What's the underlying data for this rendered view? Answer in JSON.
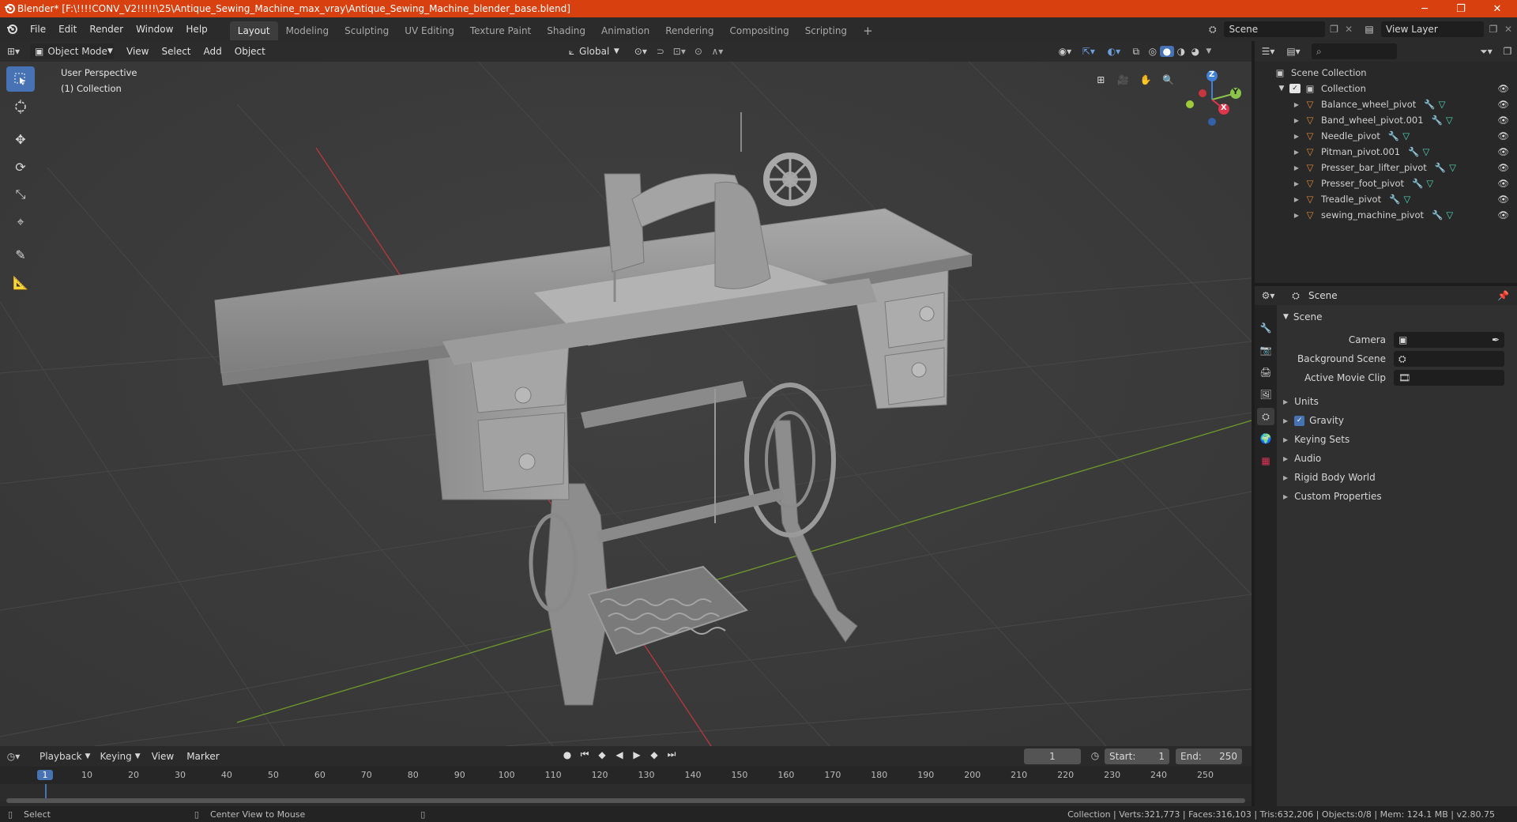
{
  "window": {
    "title": "Blender* [F:\\!!!!CONV_V2!!!!!\\25\\Antique_Sewing_Machine_max_vray\\Antique_Sewing_Machine_blender_base.blend]",
    "minimize": "─",
    "maximize": "❐",
    "close": "✕"
  },
  "menu": {
    "items": [
      "File",
      "Edit",
      "Render",
      "Window",
      "Help"
    ],
    "workspaces": [
      "Layout",
      "Modeling",
      "Sculpting",
      "UV Editing",
      "Texture Paint",
      "Shading",
      "Animation",
      "Rendering",
      "Compositing",
      "Scripting"
    ],
    "add_tab": "+",
    "scene_name": "Scene",
    "view_layer": "View Layer"
  },
  "viewport": {
    "mode": "Object Mode",
    "menus": [
      "View",
      "Select",
      "Add",
      "Object"
    ],
    "orientation": "Global",
    "perspective_label": "User Perspective",
    "collection_label": "(1) Collection",
    "gizmo_axes": [
      "X",
      "Y",
      "Z"
    ]
  },
  "outliner": {
    "search_placeholder": "",
    "scene_collection": "Scene Collection",
    "collection": "Collection",
    "objects": [
      "Balance_wheel_pivot",
      "Band_wheel_pivot.001",
      "Needle_pivot",
      "Pitman_pivot.001",
      "Presser_bar_lifter_pivot",
      "Presser_foot_pivot",
      "Treadle_pivot",
      "sewing_machine_pivot"
    ]
  },
  "properties": {
    "header": "Scene",
    "section": "Scene",
    "fields": [
      {
        "label": "Camera",
        "value": ""
      },
      {
        "label": "Background Scene",
        "value": ""
      },
      {
        "label": "Active Movie Clip",
        "value": ""
      }
    ],
    "panels": [
      "Units",
      "Gravity",
      "Keying Sets",
      "Audio",
      "Rigid Body World",
      "Custom Properties"
    ],
    "gravity_enabled": true
  },
  "timeline": {
    "menus": [
      "Playback",
      "Keying",
      "View",
      "Marker"
    ],
    "current_frame": "1",
    "start_label": "Start:",
    "start": "1",
    "end_label": "End:",
    "end": "250",
    "ruler": [
      "1",
      "10",
      "20",
      "30",
      "40",
      "50",
      "60",
      "70",
      "80",
      "90",
      "100",
      "110",
      "120",
      "130",
      "140",
      "150",
      "160",
      "170",
      "180",
      "190",
      "200",
      "210",
      "220",
      "230",
      "240",
      "250"
    ]
  },
  "status": {
    "left_action": "Select",
    "middle_action": "Center View to Mouse",
    "stats": "Collection | Verts:321,773 | Faces:316,103 | Tris:632,206 | Objects:0/8 | Mem: 124.1 MB | v2.80.75"
  },
  "colors": {
    "title_bar": "#d8400f",
    "accent": "#4772b3",
    "x_axis": "#e0354b",
    "y_axis": "#8bc34a",
    "z_axis": "#3f7fd4",
    "object_icon": "#e08a3a"
  }
}
